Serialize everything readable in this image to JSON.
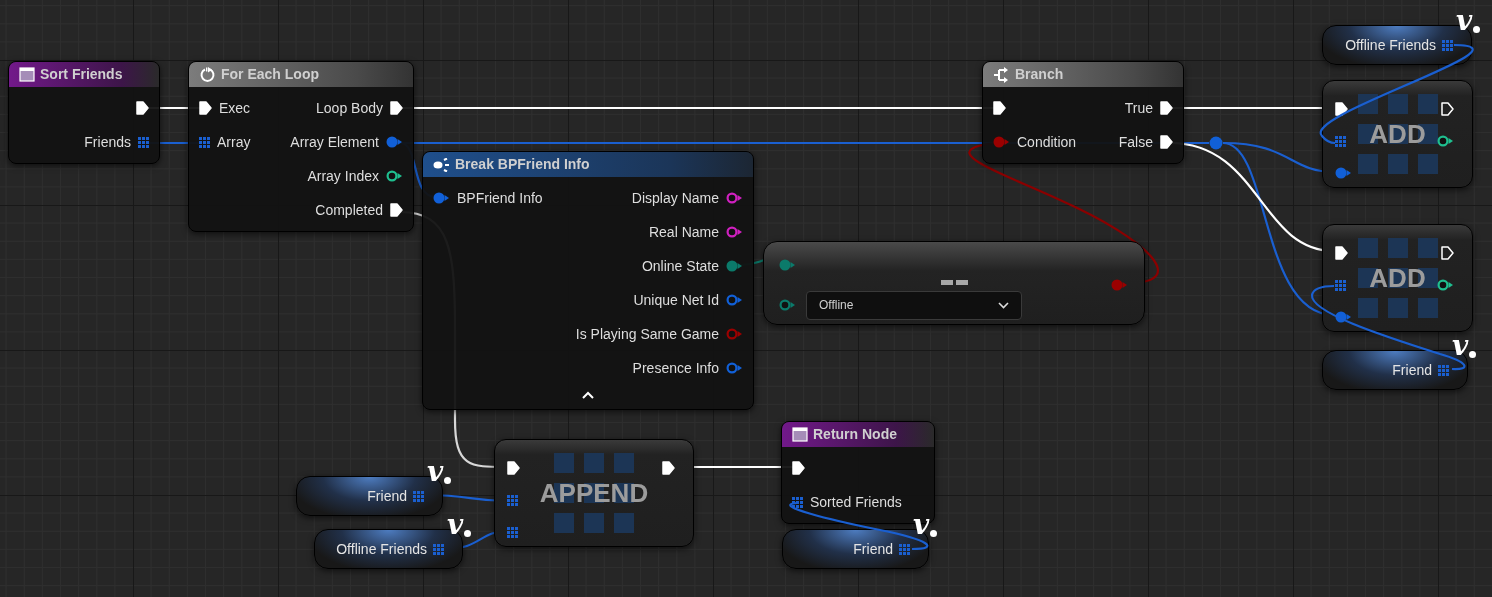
{
  "graph": {
    "nodes": [
      {
        "kind": "variable",
        "label": "Offline Friends",
        "badge": "v",
        "pin": {
          "kind": "array",
          "color": "#1a5fd0"
        }
      },
      {
        "kind": "function",
        "title": "Sort Friends",
        "outputs": [
          {
            "kind": "exec",
            "connected": true
          },
          {
            "kind": "array",
            "label": "Friends",
            "color": "#1a5fd0"
          }
        ]
      },
      {
        "kind": "macro",
        "title": "For Each Loop",
        "inputs": [
          {
            "kind": "exec",
            "label": "Exec",
            "connected": true
          },
          {
            "kind": "array",
            "label": "Array",
            "color": "#1a5fd0"
          }
        ],
        "outputs": [
          {
            "kind": "exec",
            "label": "Loop Body",
            "connected": true
          },
          {
            "kind": "data",
            "label": "Array Element",
            "color": "#1160d8",
            "connected": true
          },
          {
            "kind": "data",
            "label": "Array Index",
            "color": "#1fbf8f",
            "connected": false
          },
          {
            "kind": "exec",
            "label": "Completed",
            "connected": true
          }
        ]
      },
      {
        "kind": "branch",
        "title": "Branch",
        "inputs": [
          {
            "kind": "exec",
            "connected": true
          },
          {
            "kind": "data",
            "label": "Condition",
            "color": "#9b0000",
            "connected": true
          }
        ],
        "outputs": [
          {
            "kind": "exec",
            "label": "True",
            "connected": true
          },
          {
            "kind": "exec",
            "label": "False",
            "connected": true
          }
        ]
      },
      {
        "kind": "compact",
        "title": "ADD",
        "inputs": [
          {
            "kind": "exec",
            "connected": true
          },
          {
            "kind": "array",
            "color": "#1a5fd0"
          },
          {
            "kind": "data",
            "color": "#1160d8",
            "connected": true
          }
        ],
        "outputs": [
          {
            "kind": "exec",
            "connected": false
          },
          {
            "kind": "data",
            "color": "#1fbf8f",
            "connected": false
          }
        ]
      },
      {
        "kind": "struct",
        "title": "Break BPFriend Info",
        "expanded": true,
        "inputs": [
          {
            "kind": "data",
            "label": "BPFriend Info",
            "color": "#1160d8",
            "connected": true
          }
        ],
        "outputs": [
          {
            "kind": "data",
            "label": "Display Name",
            "color": "#d020c0",
            "connected": false
          },
          {
            "kind": "data",
            "label": "Real Name",
            "color": "#d020c0",
            "connected": false
          },
          {
            "kind": "data",
            "label": "Online State",
            "color": "#0b7a6a",
            "connected": true
          },
          {
            "kind": "data",
            "label": "Unique Net Id",
            "color": "#1160d8",
            "connected": false
          },
          {
            "kind": "data",
            "label": "Is Playing Same Game",
            "color": "#9b0000",
            "connected": false
          },
          {
            "kind": "data",
            "label": "Presence Info",
            "color": "#1160d8",
            "connected": false
          }
        ]
      },
      {
        "kind": "compact",
        "title": "ADD",
        "inputs": [
          {
            "kind": "exec",
            "connected": true
          },
          {
            "kind": "array",
            "color": "#1a5fd0"
          },
          {
            "kind": "data",
            "color": "#1160d8",
            "connected": true
          }
        ],
        "outputs": [
          {
            "kind": "exec",
            "connected": false
          },
          {
            "kind": "data",
            "color": "#1fbf8f",
            "connected": false
          }
        ]
      },
      {
        "kind": "compare",
        "inputs": [
          {
            "kind": "data",
            "color": "#0b7a6a",
            "connected": true
          },
          {
            "kind": "data",
            "color": "#0b7a6a",
            "connected": false,
            "value": "Offline"
          }
        ],
        "outputs": [
          {
            "kind": "data",
            "color": "#9b0000",
            "connected": true
          }
        ]
      },
      {
        "kind": "variable",
        "label": "Friend",
        "badge": "v",
        "pin": {
          "kind": "array",
          "color": "#1a5fd0"
        }
      },
      {
        "kind": "variable",
        "label": "Friend",
        "badge": "v",
        "pin": {
          "kind": "array",
          "color": "#1a5fd0"
        }
      },
      {
        "kind": "variable",
        "label": "Offline Friends",
        "badge": "v",
        "pin": {
          "kind": "array",
          "color": "#1a5fd0"
        }
      },
      {
        "kind": "compact",
        "title": "APPEND",
        "inputs": [
          {
            "kind": "exec",
            "connected": true
          },
          {
            "kind": "array",
            "color": "#1a5fd0"
          },
          {
            "kind": "array",
            "color": "#1a5fd0"
          }
        ],
        "outputs": [
          {
            "kind": "exec",
            "connected": true
          }
        ]
      },
      {
        "kind": "function",
        "title": "Return Node",
        "inputs": [
          {
            "kind": "exec",
            "connected": true
          },
          {
            "kind": "array",
            "label": "Sorted Friends",
            "color": "#1a5fd0"
          }
        ]
      },
      {
        "kind": "variable",
        "label": "Friend",
        "badge": "v",
        "pin": {
          "kind": "array",
          "color": "#1a5fd0"
        }
      }
    ]
  }
}
